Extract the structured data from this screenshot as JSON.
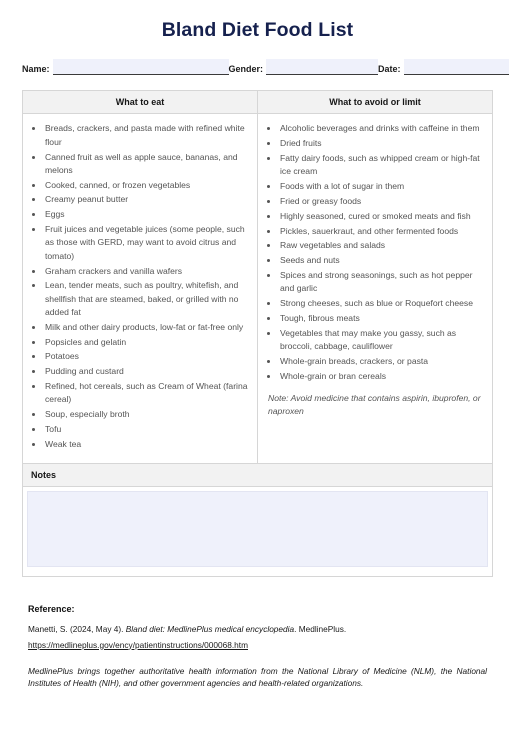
{
  "document": {
    "title": "Bland Diet Food List"
  },
  "form": {
    "fields": [
      {
        "label": "Name:",
        "value": "",
        "placeholder": ""
      },
      {
        "label": "Gender:",
        "value": "",
        "placeholder": ""
      },
      {
        "label": "Date:",
        "value": "",
        "placeholder": ""
      }
    ]
  },
  "table": {
    "columns": [
      {
        "header": "What to eat"
      },
      {
        "header": "What to avoid or limit"
      }
    ],
    "eat_items": [
      "Breads, crackers, and pasta made with refined white flour",
      "Canned fruit as well as apple sauce, bananas, and melons",
      "Cooked, canned, or frozen vegetables",
      "Creamy peanut butter",
      "Eggs",
      "Fruit juices and vegetable juices (some people, such as those with GERD, may want to avoid citrus and tomato)",
      "Graham crackers and vanilla wafers",
      "Lean, tender meats, such as poultry, whitefish, and shellfish that are steamed, baked, or grilled with no added fat",
      "Milk and other dairy products, low-fat or fat-free only",
      "Popsicles and gelatin",
      "Potatoes",
      "Pudding and custard",
      "Refined, hot cereals, such as Cream of Wheat (farina cereal)",
      "Soup, especially broth",
      "Tofu",
      "Weak tea"
    ],
    "avoid_items": [
      "Alcoholic beverages and drinks with caffeine in them",
      "Dried fruits",
      "Fatty dairy foods, such as whipped cream or high-fat ice cream",
      "Foods with a lot of sugar in them",
      "Fried or greasy foods",
      "Highly seasoned, cured or smoked meats and fish",
      "Pickles, sauerkraut, and other fermented foods",
      "Raw vegetables and salads",
      "Seeds and nuts",
      "Spices and strong seasonings, such as hot pepper and garlic",
      "Strong cheeses, such as blue or Roquefort cheese",
      "Tough, fibrous meats",
      "Vegetables that may make you gassy, such as broccoli, cabbage, cauliflower",
      "Whole-grain breads, crackers, or pasta",
      "Whole-grain or bran cereals"
    ],
    "avoid_note": "Note: Avoid medicine that contains aspirin, ibuprofen, or naproxen"
  },
  "notes": {
    "header": "Notes",
    "value": "",
    "placeholder": ""
  },
  "reference": {
    "title": "Reference:",
    "citation_pre": "Manetti, S. (2024, May 4). ",
    "citation_italic": "Bland diet: MedlinePlus medical encyclopedia",
    "citation_post": ". MedlinePlus.",
    "url": "https://medlineplus.gov/ency/patientinstructions/000068.htm",
    "blurb": "MedlinePlus brings together authoritative health information from the National Library of Medicine (NLM), the National Institutes of Health (NIH), and other government agencies and health-related organizations."
  },
  "colors": {
    "title": "#16214e",
    "field_fill": "#eff1fb",
    "header_fill": "#f2f2f2",
    "border": "#d6d6d6",
    "body_text": "#555555"
  }
}
